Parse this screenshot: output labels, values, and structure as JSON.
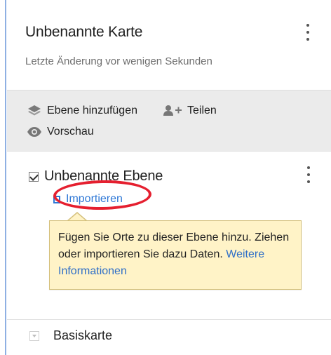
{
  "map": {
    "title": "Unbenannte Karte",
    "subtitle": "Letzte Änderung vor wenigen Sekunden"
  },
  "actions": {
    "add_layer": "Ebene hinzufügen",
    "share": "Teilen",
    "preview": "Vorschau"
  },
  "layer": {
    "name": "Unbenannte Ebene",
    "checked": true,
    "import_label": "Importieren",
    "tooltip": {
      "text_before_link": "Fügen Sie Orte zu dieser Ebene hinzu. Ziehen oder importieren Sie dazu Daten.",
      "link": "Weitere Informationen"
    }
  },
  "base_map": {
    "label": "Basiskarte"
  },
  "colors": {
    "accent": "#2f78d6",
    "highlight": "#e51f2f",
    "tooltip_bg": "#fff3c7",
    "actions_bg": "#ebebeb"
  },
  "icons": {
    "map_menu": "more-vert-icon",
    "add_layer": "layers-icon",
    "share": "person-add-icon",
    "preview": "eye-icon",
    "layer_checkbox": "checkbox-checked-icon",
    "layer_menu": "more-vert-icon",
    "import": "import-icon",
    "base_map_toggle": "chevron-down-icon"
  }
}
